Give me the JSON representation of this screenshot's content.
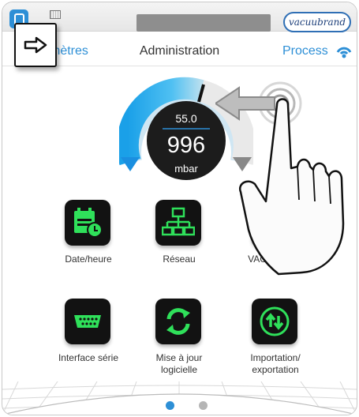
{
  "header": {
    "brand": "vacuubrand",
    "back_label": "mètres",
    "title": "Administration",
    "process_label": "Process"
  },
  "gauge": {
    "setpoint": "55.0",
    "value": "996",
    "unit": "mbar"
  },
  "tiles": [
    {
      "label": "Date/heure",
      "icon": "calendar-clock-icon"
    },
    {
      "label": "Réseau",
      "icon": "network-icon"
    },
    {
      "label": "VACUU·BUS",
      "icon": "bus-network-icon"
    },
    {
      "label": "Interface série",
      "icon": "serial-port-icon"
    },
    {
      "label": "Mise à jour\nlogicielle",
      "icon": "refresh-icon"
    },
    {
      "label": "Importation/\nexportation",
      "icon": "import-export-icon"
    }
  ],
  "pagination": {
    "current": 1,
    "total": 2
  },
  "colors": {
    "accent": "#2d8fd6",
    "icon_green": "#2fe05a",
    "tile_bg": "#121212"
  }
}
